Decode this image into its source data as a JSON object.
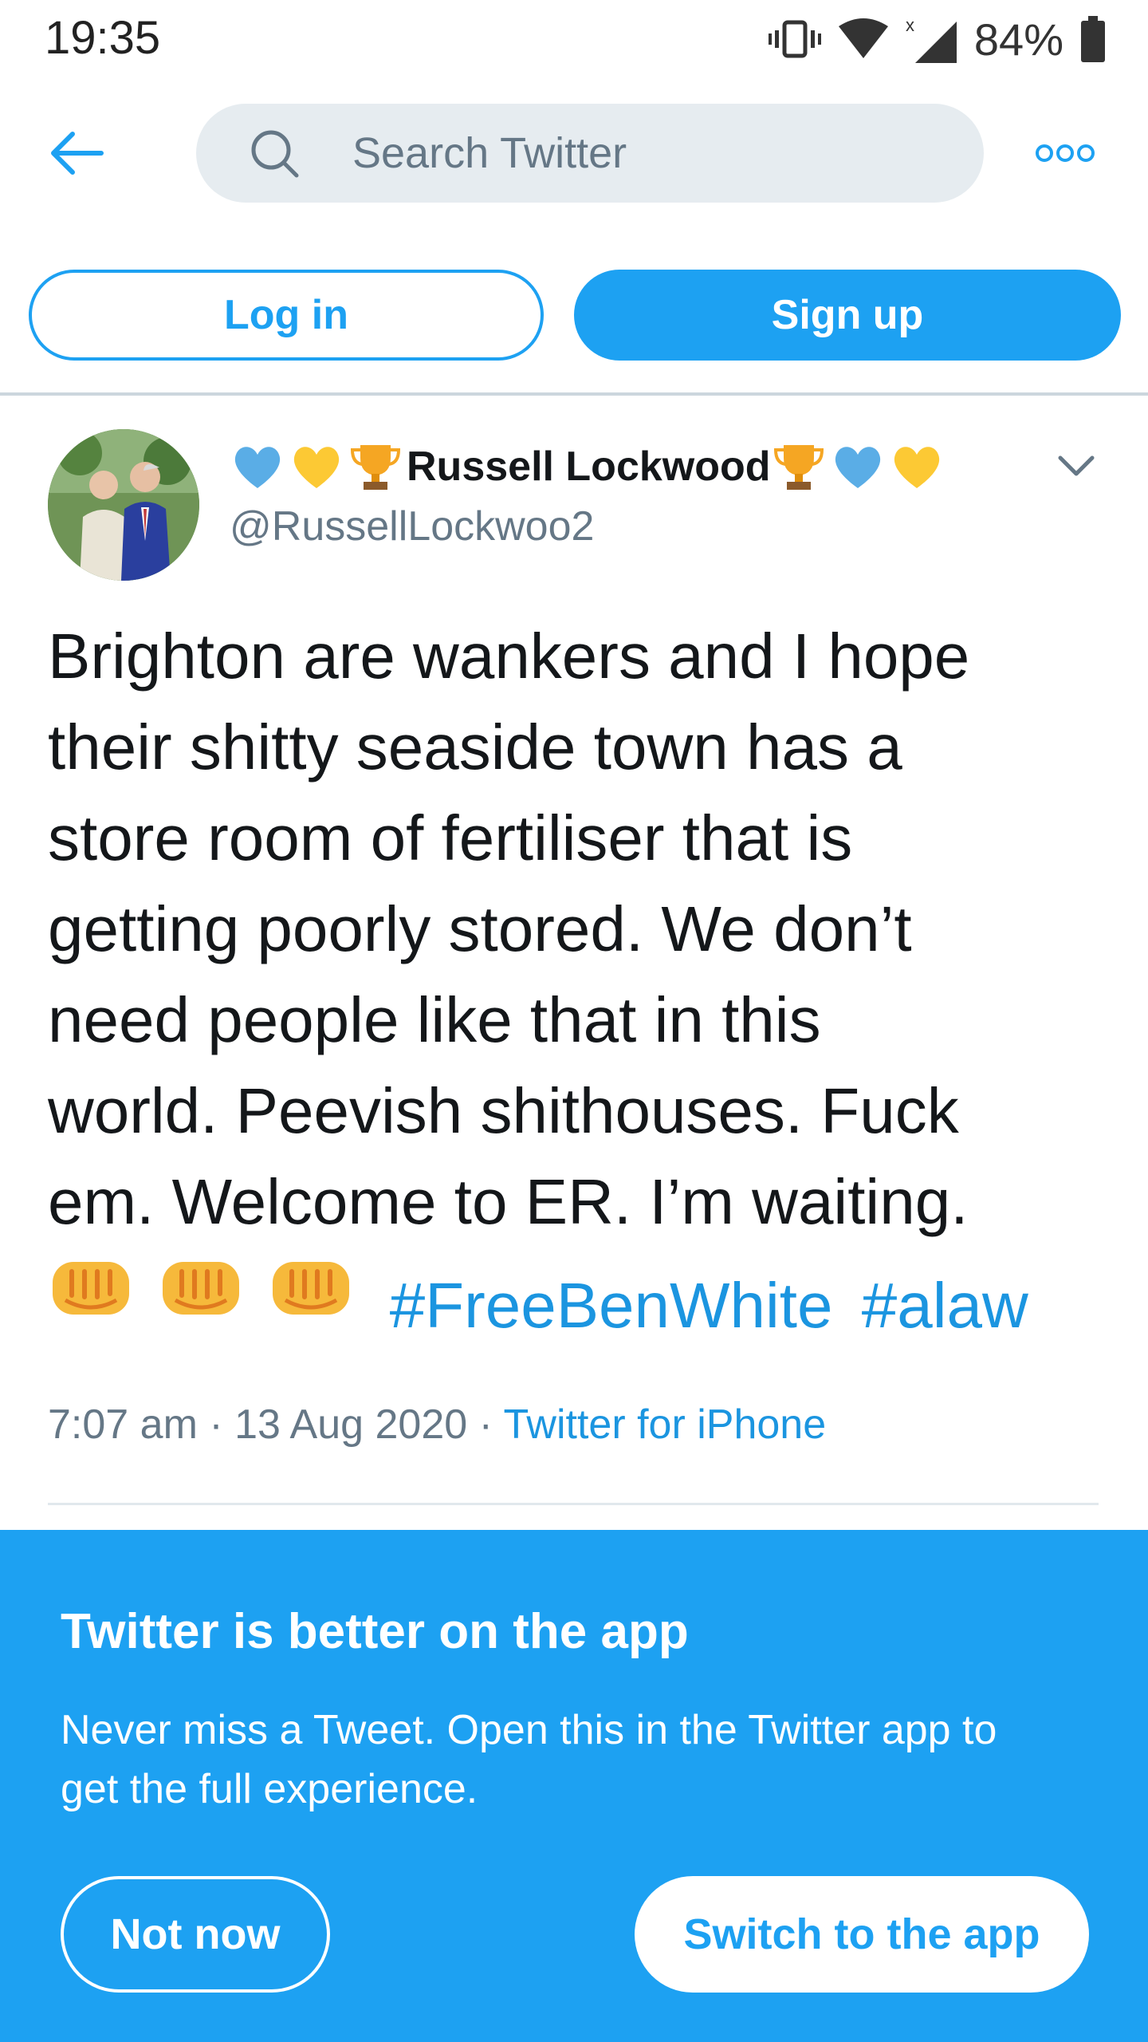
{
  "status_bar": {
    "time": "19:35",
    "battery": "84%",
    "icons": [
      "vibrate-icon",
      "wifi-icon",
      "signal-icon",
      "battery-icon"
    ]
  },
  "header": {
    "search_placeholder": "Search Twitter",
    "back_icon": "back-arrow-icon",
    "more_icon": "more-icon"
  },
  "auth": {
    "login_label": "Log in",
    "signup_label": "Sign up"
  },
  "tweet": {
    "author_name": "Russell Lockwood",
    "author_handle": "@RussellLockwoo2",
    "name_emojis_before": [
      "blue-heart-icon",
      "yellow-heart-icon",
      "trophy-icon"
    ],
    "name_emojis_after": [
      "trophy-icon",
      "blue-heart-icon",
      "yellow-heart-icon"
    ],
    "text_lines": [
      "Brighton are wankers and I hope",
      "their shitty seaside town has a",
      "store room of fertiliser that is",
      "getting poorly stored. We don’t",
      "need people like that in this",
      "world. Peevish shithouses. Fuck",
      "em. Welcome to ER. I’m waiting."
    ],
    "fist_emojis": [
      "fist-icon",
      "fist-icon",
      "fist-icon"
    ],
    "hashtags": [
      "#FreeBenWhite",
      "#alaw"
    ],
    "time": "7:07 am",
    "date": "13 Aug 2020",
    "separator": "·",
    "source": "Twitter for iPhone"
  },
  "app_banner": {
    "title": "Twitter is better on the app",
    "body": "Never miss a Tweet. Open this in the Twitter app to get the full experience.",
    "not_now_label": "Not now",
    "switch_label": "Switch to the app"
  },
  "colors": {
    "twitter_blue": "#1da1f2",
    "link_blue": "#1b95e0",
    "secondary_text": "#657786",
    "search_bg": "#e6ecf0"
  }
}
